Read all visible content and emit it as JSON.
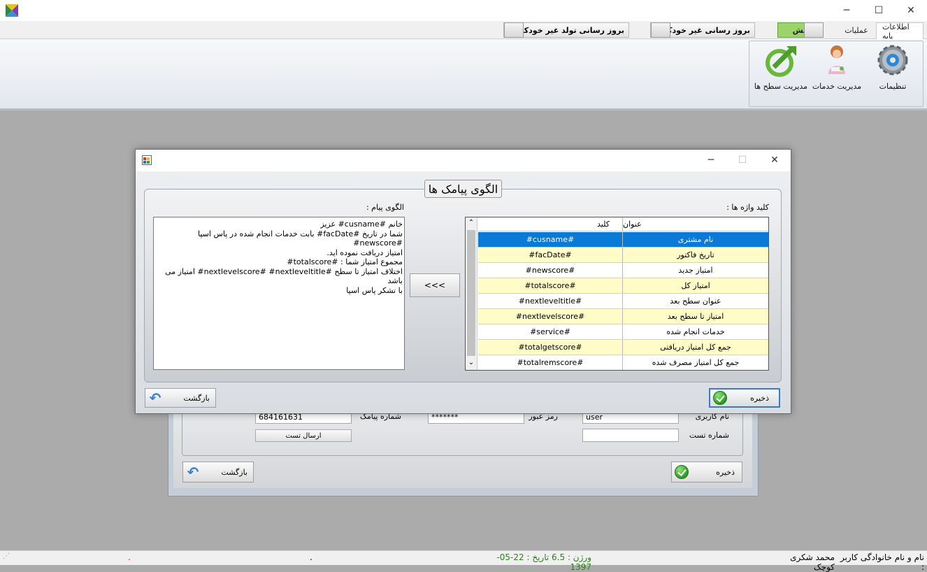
{
  "window": {
    "minimize": "─",
    "maximize": "☐",
    "close": "✕"
  },
  "ribbon": {
    "tabs": [
      "اطلاعات پایه",
      "عملیات",
      "نمایش"
    ],
    "buttons": {
      "update_non_auto": "بروز رسانی غیر خودکار",
      "update_birthday_non_auto": "بروز رسانی تولد غیر خودکار"
    },
    "items": {
      "settings": "تنظیمات",
      "services": "مدیریت خدمات",
      "levels": "مدیریت سطح ها"
    }
  },
  "bg_form": {
    "username_label": "نام کاربری",
    "username_value": "user",
    "password_label": "رمز عبور",
    "password_value": "*******",
    "sms_number_label": "شماره پیامک",
    "sms_number_value": "684161631",
    "test_number_label": "شماره تست",
    "test_number_value": "",
    "send_test": "ارسال تست",
    "save": "ذخیره",
    "back": "بازگشت"
  },
  "dialog": {
    "title": "الگوی پیامک ها",
    "keywords_label": "کلید واژه ها :",
    "message_label": "الگوی پیام :",
    "insert_button": "<<<",
    "save": "ذخیره",
    "back": "بازگشت",
    "message_lines": [
      "خانم #cusname# عزیز",
      "شما در تاریخ #facDate# بابت خدمات انجام شده در پاس اسپا #newscore#",
      "امتیاز دریافت نموده اید.",
      "مجموع امتیاز شما : #totalscore#",
      "اختلاف امتیاز تا سطح #nextlevelscore# #nextleveltitle# امتیاز می باشد",
      "با تشکر پاس اسپا"
    ],
    "grid": {
      "columns": {
        "key": "کلید",
        "title": "عنوان"
      },
      "rows": [
        {
          "title": "نام مشتری",
          "key": "#cusname#"
        },
        {
          "title": "تاریخ فاکتور",
          "key": "#facDate#"
        },
        {
          "title": "امتیاز جدید",
          "key": "#newscore#"
        },
        {
          "title": "امتیاز کل",
          "key": "#totalscore#"
        },
        {
          "title": "عنوان سطح بعد",
          "key": "#nextleveltitle#"
        },
        {
          "title": "امتیاز تا سطح بعد",
          "key": "#nextlevelscore#"
        },
        {
          "title": "خدمات انجام شده",
          "key": "#service#"
        },
        {
          "title": "جمع کل امتیاز دریافتی",
          "key": "#totalgetscore#"
        },
        {
          "title": "جمع کل امتیاز مصرف شده",
          "key": "#totalremscore#"
        }
      ]
    }
  },
  "status": {
    "user_label": "نام و نام خانوادگی کاربر :",
    "user_name": "محمد شکری کوچک",
    "version": "ورژن : 6.5 تاریخ : 22-05-1397",
    "dot1": ".",
    "dot2": "."
  },
  "colors": {
    "selected_row": "#0a7ad6",
    "alt_row": "#fffcc8",
    "status_green": "#2e7d20"
  }
}
